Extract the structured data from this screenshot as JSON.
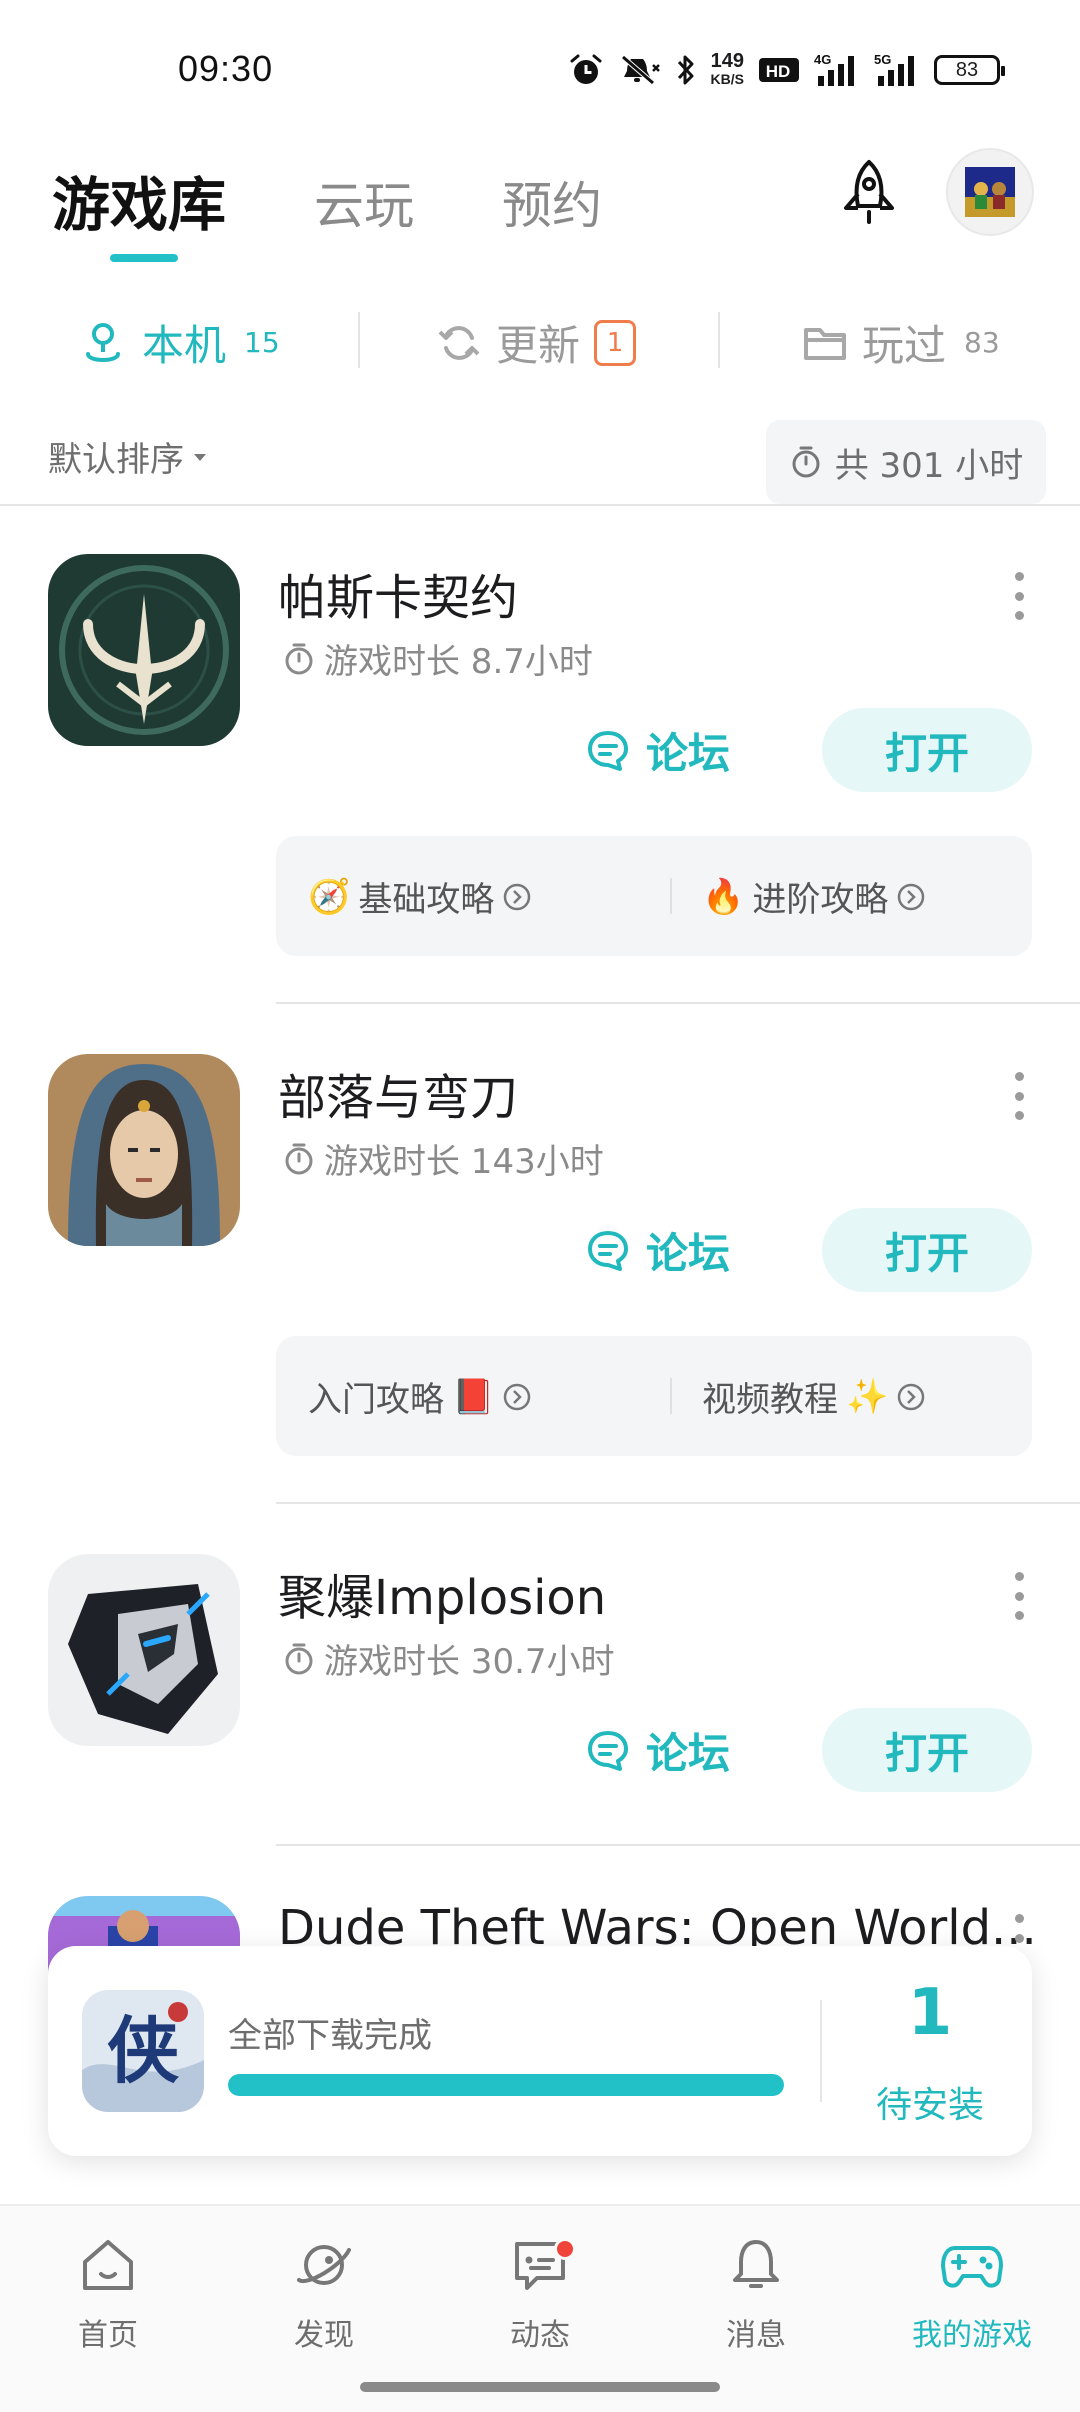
{
  "status_bar": {
    "time": "09:30",
    "net_speed_value": "149",
    "net_speed_unit": "KB/S",
    "hd_label": "HD",
    "net1": "4G",
    "net2": "5G",
    "battery": "83",
    "icons": [
      "alarm-icon",
      "mute-icon",
      "bluetooth-icon",
      "hd-icon",
      "signal-icon",
      "signal-icon",
      "battery-icon"
    ]
  },
  "header": {
    "tabs": [
      {
        "label": "游戏库",
        "active": true
      },
      {
        "label": "云玩",
        "active": false
      },
      {
        "label": "预约",
        "active": false
      }
    ],
    "accent_color": "#21c1c7"
  },
  "filter_tabs": [
    {
      "label": "本机",
      "count": "15",
      "active": true,
      "icon": "location-pin-icon"
    },
    {
      "label": "更新",
      "badge": "1",
      "active": false,
      "icon": "refresh-icon"
    },
    {
      "label": "玩过",
      "count": "83",
      "active": false,
      "icon": "folder-icon"
    }
  ],
  "sort": {
    "label": "默认排序",
    "total_label": "共 301 小时"
  },
  "games": [
    {
      "title": "帕斯卡契约",
      "playtime": "游戏时长 8.7小时",
      "forum_label": "论坛",
      "open_label": "打开",
      "guides": [
        {
          "prefix": "🧭",
          "label": "基础攻略",
          "suffix": ""
        },
        {
          "prefix": "🔥",
          "label": "进阶攻略",
          "suffix": ""
        }
      ]
    },
    {
      "title": "部落与弯刀",
      "playtime": "游戏时长 143小时",
      "forum_label": "论坛",
      "open_label": "打开",
      "guides": [
        {
          "prefix": "",
          "label": "入门攻略",
          "suffix": "📕"
        },
        {
          "prefix": "",
          "label": "视频教程",
          "suffix": "✨"
        }
      ]
    },
    {
      "title": "聚爆Implosion",
      "playtime": "游戏时长 30.7小时",
      "forum_label": "论坛",
      "open_label": "打开"
    },
    {
      "title": "Dude Theft Wars: Open World..."
    }
  ],
  "download": {
    "status_text": "全部下载完成",
    "progress": 1.0,
    "pending_count": "1",
    "pending_label": "待安装"
  },
  "bottom_nav": [
    {
      "label": "首页",
      "icon": "home-icon",
      "active": false
    },
    {
      "label": "发现",
      "icon": "planet-icon",
      "active": false
    },
    {
      "label": "动态",
      "icon": "message-icon",
      "active": false,
      "dot": true
    },
    {
      "label": "消息",
      "icon": "bell-icon",
      "active": false
    },
    {
      "label": "我的游戏",
      "icon": "gamepad-icon",
      "active": true
    }
  ]
}
